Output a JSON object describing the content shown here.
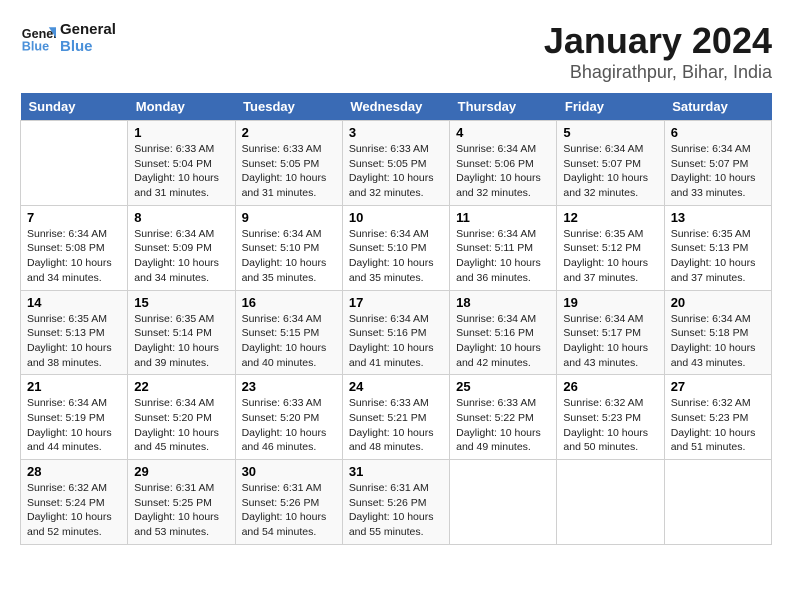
{
  "logo": {
    "line1": "General",
    "line2": "Blue"
  },
  "title": "January 2024",
  "subtitle": "Bhagirathpur, Bihar, India",
  "headers": [
    "Sunday",
    "Monday",
    "Tuesday",
    "Wednesday",
    "Thursday",
    "Friday",
    "Saturday"
  ],
  "weeks": [
    [
      {
        "day": "",
        "info": ""
      },
      {
        "day": "1",
        "info": "Sunrise: 6:33 AM\nSunset: 5:04 PM\nDaylight: 10 hours\nand 31 minutes."
      },
      {
        "day": "2",
        "info": "Sunrise: 6:33 AM\nSunset: 5:05 PM\nDaylight: 10 hours\nand 31 minutes."
      },
      {
        "day": "3",
        "info": "Sunrise: 6:33 AM\nSunset: 5:05 PM\nDaylight: 10 hours\nand 32 minutes."
      },
      {
        "day": "4",
        "info": "Sunrise: 6:34 AM\nSunset: 5:06 PM\nDaylight: 10 hours\nand 32 minutes."
      },
      {
        "day": "5",
        "info": "Sunrise: 6:34 AM\nSunset: 5:07 PM\nDaylight: 10 hours\nand 32 minutes."
      },
      {
        "day": "6",
        "info": "Sunrise: 6:34 AM\nSunset: 5:07 PM\nDaylight: 10 hours\nand 33 minutes."
      }
    ],
    [
      {
        "day": "7",
        "info": "Sunrise: 6:34 AM\nSunset: 5:08 PM\nDaylight: 10 hours\nand 34 minutes."
      },
      {
        "day": "8",
        "info": "Sunrise: 6:34 AM\nSunset: 5:09 PM\nDaylight: 10 hours\nand 34 minutes."
      },
      {
        "day": "9",
        "info": "Sunrise: 6:34 AM\nSunset: 5:10 PM\nDaylight: 10 hours\nand 35 minutes."
      },
      {
        "day": "10",
        "info": "Sunrise: 6:34 AM\nSunset: 5:10 PM\nDaylight: 10 hours\nand 35 minutes."
      },
      {
        "day": "11",
        "info": "Sunrise: 6:34 AM\nSunset: 5:11 PM\nDaylight: 10 hours\nand 36 minutes."
      },
      {
        "day": "12",
        "info": "Sunrise: 6:35 AM\nSunset: 5:12 PM\nDaylight: 10 hours\nand 37 minutes."
      },
      {
        "day": "13",
        "info": "Sunrise: 6:35 AM\nSunset: 5:13 PM\nDaylight: 10 hours\nand 37 minutes."
      }
    ],
    [
      {
        "day": "14",
        "info": "Sunrise: 6:35 AM\nSunset: 5:13 PM\nDaylight: 10 hours\nand 38 minutes."
      },
      {
        "day": "15",
        "info": "Sunrise: 6:35 AM\nSunset: 5:14 PM\nDaylight: 10 hours\nand 39 minutes."
      },
      {
        "day": "16",
        "info": "Sunrise: 6:34 AM\nSunset: 5:15 PM\nDaylight: 10 hours\nand 40 minutes."
      },
      {
        "day": "17",
        "info": "Sunrise: 6:34 AM\nSunset: 5:16 PM\nDaylight: 10 hours\nand 41 minutes."
      },
      {
        "day": "18",
        "info": "Sunrise: 6:34 AM\nSunset: 5:16 PM\nDaylight: 10 hours\nand 42 minutes."
      },
      {
        "day": "19",
        "info": "Sunrise: 6:34 AM\nSunset: 5:17 PM\nDaylight: 10 hours\nand 43 minutes."
      },
      {
        "day": "20",
        "info": "Sunrise: 6:34 AM\nSunset: 5:18 PM\nDaylight: 10 hours\nand 43 minutes."
      }
    ],
    [
      {
        "day": "21",
        "info": "Sunrise: 6:34 AM\nSunset: 5:19 PM\nDaylight: 10 hours\nand 44 minutes."
      },
      {
        "day": "22",
        "info": "Sunrise: 6:34 AM\nSunset: 5:20 PM\nDaylight: 10 hours\nand 45 minutes."
      },
      {
        "day": "23",
        "info": "Sunrise: 6:33 AM\nSunset: 5:20 PM\nDaylight: 10 hours\nand 46 minutes."
      },
      {
        "day": "24",
        "info": "Sunrise: 6:33 AM\nSunset: 5:21 PM\nDaylight: 10 hours\nand 48 minutes."
      },
      {
        "day": "25",
        "info": "Sunrise: 6:33 AM\nSunset: 5:22 PM\nDaylight: 10 hours\nand 49 minutes."
      },
      {
        "day": "26",
        "info": "Sunrise: 6:32 AM\nSunset: 5:23 PM\nDaylight: 10 hours\nand 50 minutes."
      },
      {
        "day": "27",
        "info": "Sunrise: 6:32 AM\nSunset: 5:23 PM\nDaylight: 10 hours\nand 51 minutes."
      }
    ],
    [
      {
        "day": "28",
        "info": "Sunrise: 6:32 AM\nSunset: 5:24 PM\nDaylight: 10 hours\nand 52 minutes."
      },
      {
        "day": "29",
        "info": "Sunrise: 6:31 AM\nSunset: 5:25 PM\nDaylight: 10 hours\nand 53 minutes."
      },
      {
        "day": "30",
        "info": "Sunrise: 6:31 AM\nSunset: 5:26 PM\nDaylight: 10 hours\nand 54 minutes."
      },
      {
        "day": "31",
        "info": "Sunrise: 6:31 AM\nSunset: 5:26 PM\nDaylight: 10 hours\nand 55 minutes."
      },
      {
        "day": "",
        "info": ""
      },
      {
        "day": "",
        "info": ""
      },
      {
        "day": "",
        "info": ""
      }
    ]
  ]
}
